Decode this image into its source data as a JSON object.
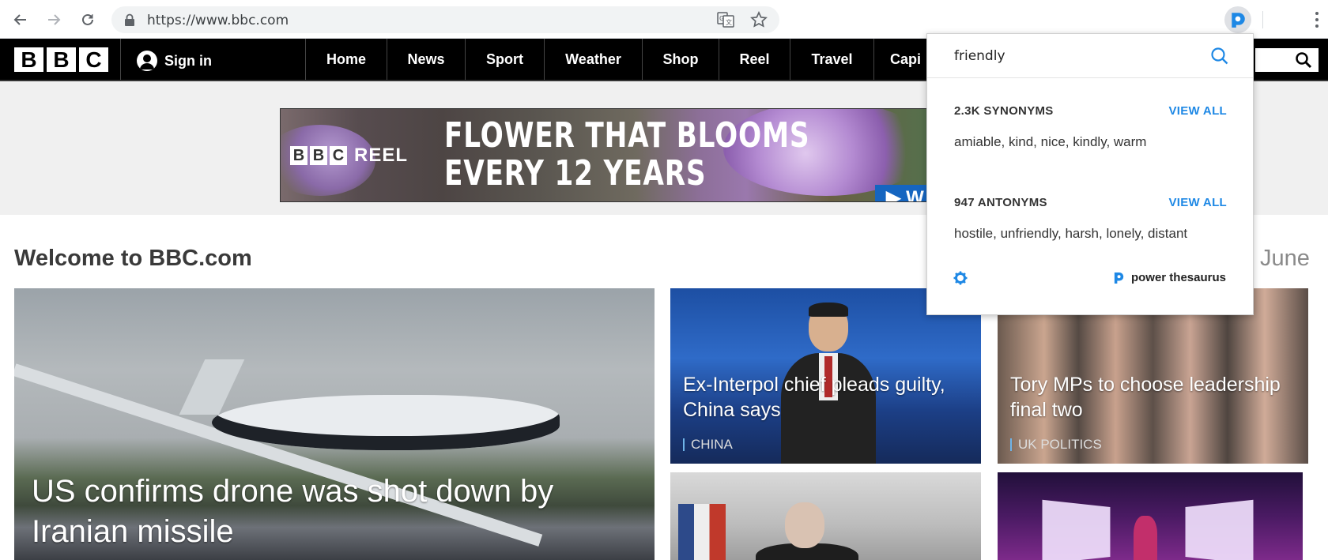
{
  "browser": {
    "url": "https://www.bbc.com"
  },
  "nav": {
    "sign_in": "Sign in",
    "items": [
      "Home",
      "News",
      "Sport",
      "Weather",
      "Shop",
      "Reel",
      "Travel",
      "Capi"
    ]
  },
  "banner": {
    "brand": "REEL",
    "headline_line1": "FLOWER THAT BLOOMS",
    "headline_line2": "EVERY 12 YEARS",
    "watch": "▶ W"
  },
  "main": {
    "welcome": "Welcome to BBC.com",
    "date": "June",
    "hero": {
      "title": "US confirms drone was shot down by Iranian missile"
    },
    "cards": [
      {
        "title": "Ex-Interpol chief pleads guilty, China says",
        "tag": "CHINA"
      },
      {
        "title": "Tory MPs to choose leadership final two",
        "tag": "UK POLITICS"
      }
    ]
  },
  "thesaurus": {
    "query": "friendly",
    "synonyms_title": "2.3K SYNONYMS",
    "synonyms_view_all": "VIEW ALL",
    "synonyms": "amiable, kind, nice, kindly, warm",
    "antonyms_title": "947 ANTONYMS",
    "antonyms_view_all": "VIEW ALL",
    "antonyms": "hostile, unfriendly, harsh, lonely, distant",
    "brand": "power thesaurus",
    "accent_color": "#1e88e5"
  }
}
